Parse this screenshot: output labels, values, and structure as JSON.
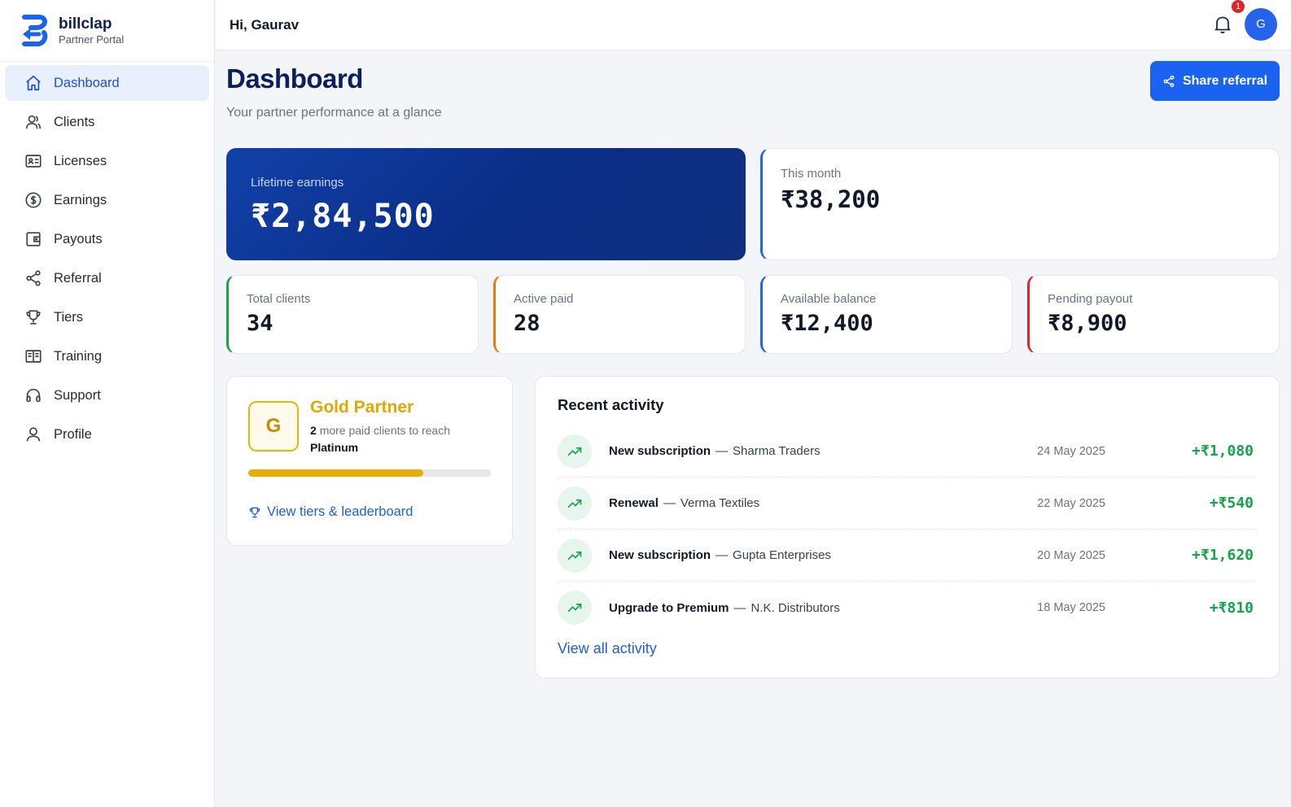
{
  "brand": {
    "name": "billclap",
    "subtitle": "Partner Portal",
    "color": "#1a63f0"
  },
  "sidebar": {
    "items": [
      {
        "label": "Dashboard",
        "icon": "home-icon",
        "active": true
      },
      {
        "label": "Clients",
        "icon": "users-icon"
      },
      {
        "label": "Licenses",
        "icon": "id-card-icon"
      },
      {
        "label": "Earnings",
        "icon": "dollar-circle-icon"
      },
      {
        "label": "Payouts",
        "icon": "wallet-icon"
      },
      {
        "label": "Referral",
        "icon": "share-icon"
      },
      {
        "label": "Tiers",
        "icon": "trophy-icon"
      },
      {
        "label": "Training",
        "icon": "book-open-icon"
      },
      {
        "label": "Support",
        "icon": "headphones-icon"
      },
      {
        "label": "Profile",
        "icon": "user-icon"
      }
    ]
  },
  "header": {
    "greeting": "Hi, Gaurav",
    "notification_count": "1",
    "avatar_initial": "G"
  },
  "page": {
    "title": "Dashboard",
    "subtitle": "Your partner performance at a glance",
    "share_button": "Share referral"
  },
  "hero": {
    "label": "Lifetime earnings",
    "value": "₹2,84,500"
  },
  "month": {
    "label": "This month",
    "value": "₹38,200"
  },
  "stats": [
    {
      "label": "Total clients",
      "value": "34",
      "color": "#16a34a"
    },
    {
      "label": "Active paid",
      "value": "28",
      "color": "#ea7a0c"
    },
    {
      "label": "Available balance",
      "value": "₹12,400",
      "color": "#2563eb"
    },
    {
      "label": "Pending payout",
      "value": "₹8,900",
      "color": "#dc2626"
    }
  ],
  "tier": {
    "badge_letter": "G",
    "name": "Gold Partner",
    "clients_needed": "2",
    "line1_rest": "more paid clients to reach",
    "next_tier": "Platinum",
    "progress_fraction": 0.72,
    "link": "View tiers & leaderboard"
  },
  "activity": {
    "title": "Recent activity",
    "rows": [
      {
        "type": "New subscription",
        "sep": "—",
        "client": "Sharma Traders",
        "date": "24 May 2025",
        "amount": "+₹1,080"
      },
      {
        "type": "Renewal",
        "sep": "—",
        "client": "Verma Textiles",
        "date": "22 May 2025",
        "amount": "+₹540"
      },
      {
        "type": "New subscription",
        "sep": "—",
        "client": "Gupta Enterprises",
        "date": "20 May 2025",
        "amount": "+₹1,620"
      },
      {
        "type": "Upgrade to Premium",
        "sep": "—",
        "client": "N.K. Distributors",
        "date": "18 May 2025",
        "amount": "+₹810"
      }
    ],
    "view_all": "View all activity"
  }
}
